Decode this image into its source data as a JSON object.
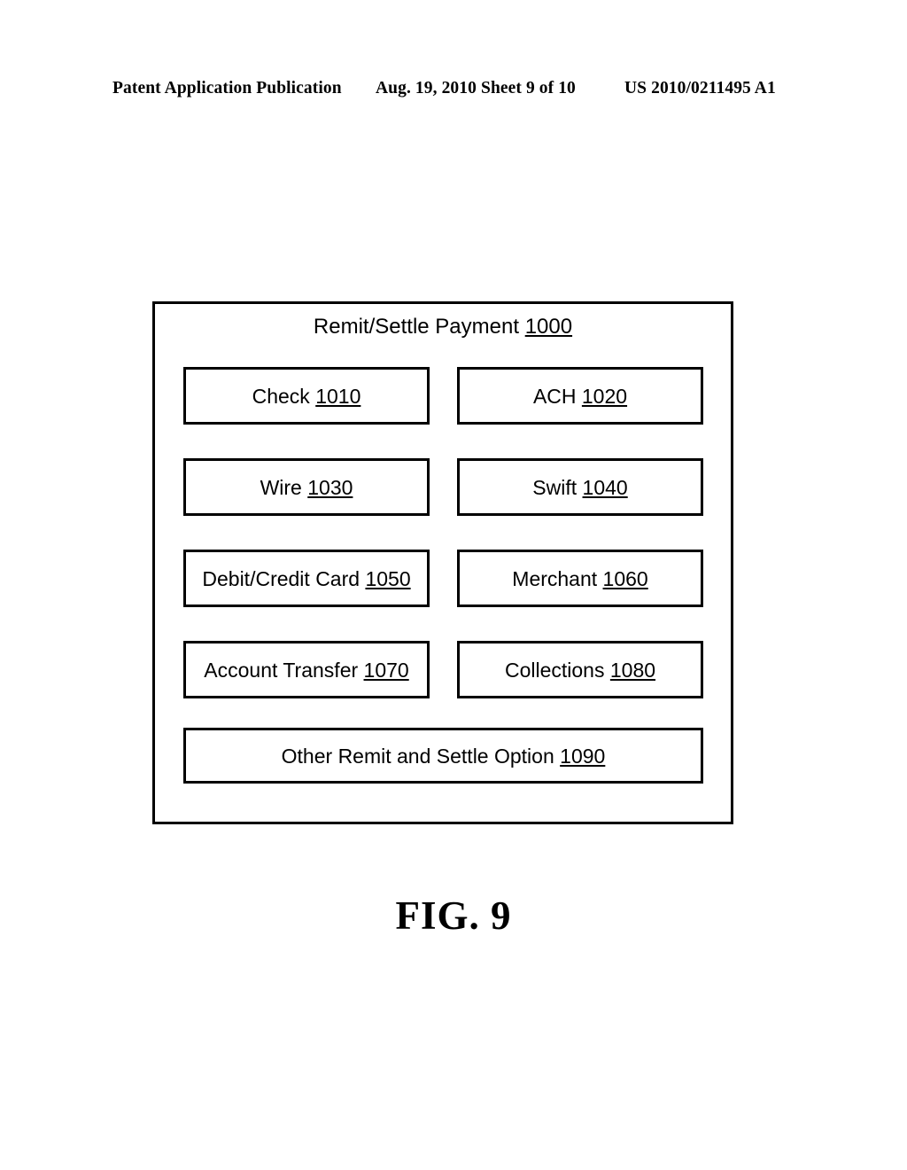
{
  "header": {
    "publication": "Patent Application Publication",
    "date": "Aug. 19, 2010",
    "sheet": "Sheet 9 of 10",
    "patent_number": "US 2010/0211495 A1"
  },
  "figure": {
    "caption": "FIG. 9",
    "container": {
      "title_text": "Remit/Settle Payment",
      "title_ref": "1000"
    },
    "nodes": [
      {
        "label": "Check",
        "ref": "1010",
        "column": "left",
        "row": 1
      },
      {
        "label": "ACH",
        "ref": "1020",
        "column": "right",
        "row": 1
      },
      {
        "label": "Wire",
        "ref": "1030",
        "column": "left",
        "row": 2
      },
      {
        "label": "Swift",
        "ref": "1040",
        "column": "right",
        "row": 2
      },
      {
        "label": "Debit/Credit Card",
        "ref": "1050",
        "column": "left",
        "row": 3
      },
      {
        "label": "Merchant",
        "ref": "1060",
        "column": "right",
        "row": 3
      },
      {
        "label": "Account Transfer",
        "ref": "1070",
        "column": "left",
        "row": 4
      },
      {
        "label": "Collections",
        "ref": "1080",
        "column": "right",
        "row": 4
      },
      {
        "label": "Other Remit and Settle Option",
        "ref": "1090",
        "column": "wide",
        "row": 5
      }
    ]
  },
  "colors": {
    "ink": "#000000",
    "paper": "#ffffff"
  }
}
